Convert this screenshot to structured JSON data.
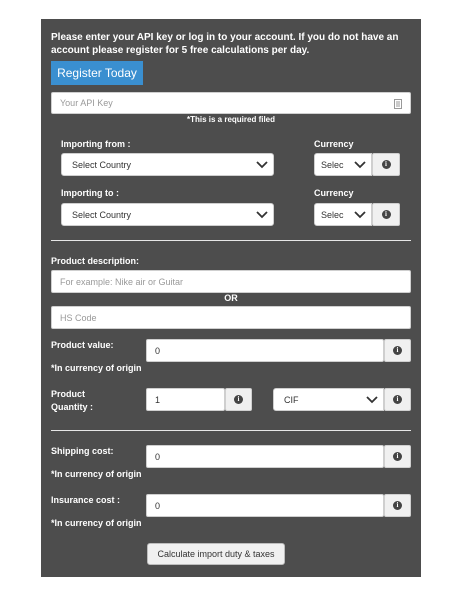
{
  "intro_text": "Please enter your API key or log in to your account. If you do not have an account please register for 5 free calculations per day.",
  "register_button": "Register Today",
  "api_key": {
    "placeholder": "Your API Key",
    "note": "*This is a required filed"
  },
  "importing_from": {
    "label": "Importing from :",
    "select": "Select Country"
  },
  "importing_to": {
    "label": "Importing to :",
    "select": "Select Country"
  },
  "currency_from": {
    "label": "Currency",
    "select": "Selec"
  },
  "currency_to": {
    "label": "Currency",
    "select": "Selec"
  },
  "product_description": {
    "label": "Product description:",
    "placeholder": "For example: Nike air or Guitar"
  },
  "or_text": "OR",
  "hs_code": {
    "placeholder": "HS Code"
  },
  "product_value": {
    "label": "Product value:",
    "note": "*In currency of origin",
    "value": "0"
  },
  "product_quantity": {
    "label_line1": "Product",
    "label_line2": "Quantity :",
    "value": "1",
    "incoterm": "CIF"
  },
  "shipping_cost": {
    "label": "Shipping cost:",
    "note": "*In currency of origin",
    "value": "0"
  },
  "insurance_cost": {
    "label": "Insurance cost :",
    "note": "*In currency of origin",
    "value": "0"
  },
  "calculate_button": "Calculate import duty & taxes",
  "colors": {
    "panel": "#4d4d4d",
    "accent": "#3a8fd0"
  },
  "icons": {
    "info": "info-icon",
    "dropdown": "chevron-down-icon",
    "api": "clipboard-icon"
  }
}
